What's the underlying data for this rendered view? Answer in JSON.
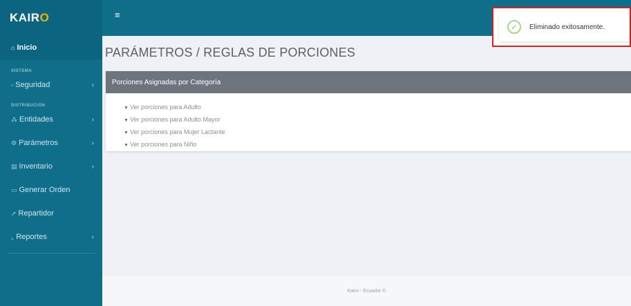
{
  "brand": {
    "prefix": "KAIR",
    "accent": "O"
  },
  "topbar": {
    "menu_icon": "≡"
  },
  "sidebar": {
    "home": {
      "icon": "home-icon",
      "label": "Inicio"
    },
    "section_sistema": "SISTEMA",
    "section_distribucion": "DISTRIBUCIÓN",
    "items": [
      {
        "icon": "lock-icon",
        "label": "Seguridad",
        "has_submenu": true
      },
      {
        "icon": "users-icon",
        "label": "Entidades",
        "has_submenu": true
      },
      {
        "icon": "settings-icon",
        "label": "Parámetros",
        "has_submenu": true
      },
      {
        "icon": "inventory-icon",
        "label": "Inventario",
        "has_submenu": true
      },
      {
        "icon": "order-icon",
        "label": "Generar Orden",
        "has_submenu": false
      },
      {
        "icon": "delivery-icon",
        "label": "Repartidor",
        "has_submenu": false
      },
      {
        "icon": "chart-icon",
        "label": "Reportes",
        "has_submenu": true
      }
    ]
  },
  "toast": {
    "message": "Eliminado exitosamente."
  },
  "page": {
    "title": "PARÁMETROS / REGLAS DE PORCIONES"
  },
  "card": {
    "header": "Porciones Asignadas por Categoría",
    "links": [
      "Ver porciones para Adulto",
      "Ver porciones para Adulto Mayor",
      "Ver porciones para Mujer Lactante",
      "Ver porciones para Niño"
    ]
  },
  "footer": {
    "text": "Kairo - Ecuador ©"
  },
  "colors": {
    "primary": "#0f6f8a",
    "accent": "#f0b400",
    "card_header": "#6e747c",
    "toast_border": "#d32020",
    "success": "#7cc05c"
  }
}
